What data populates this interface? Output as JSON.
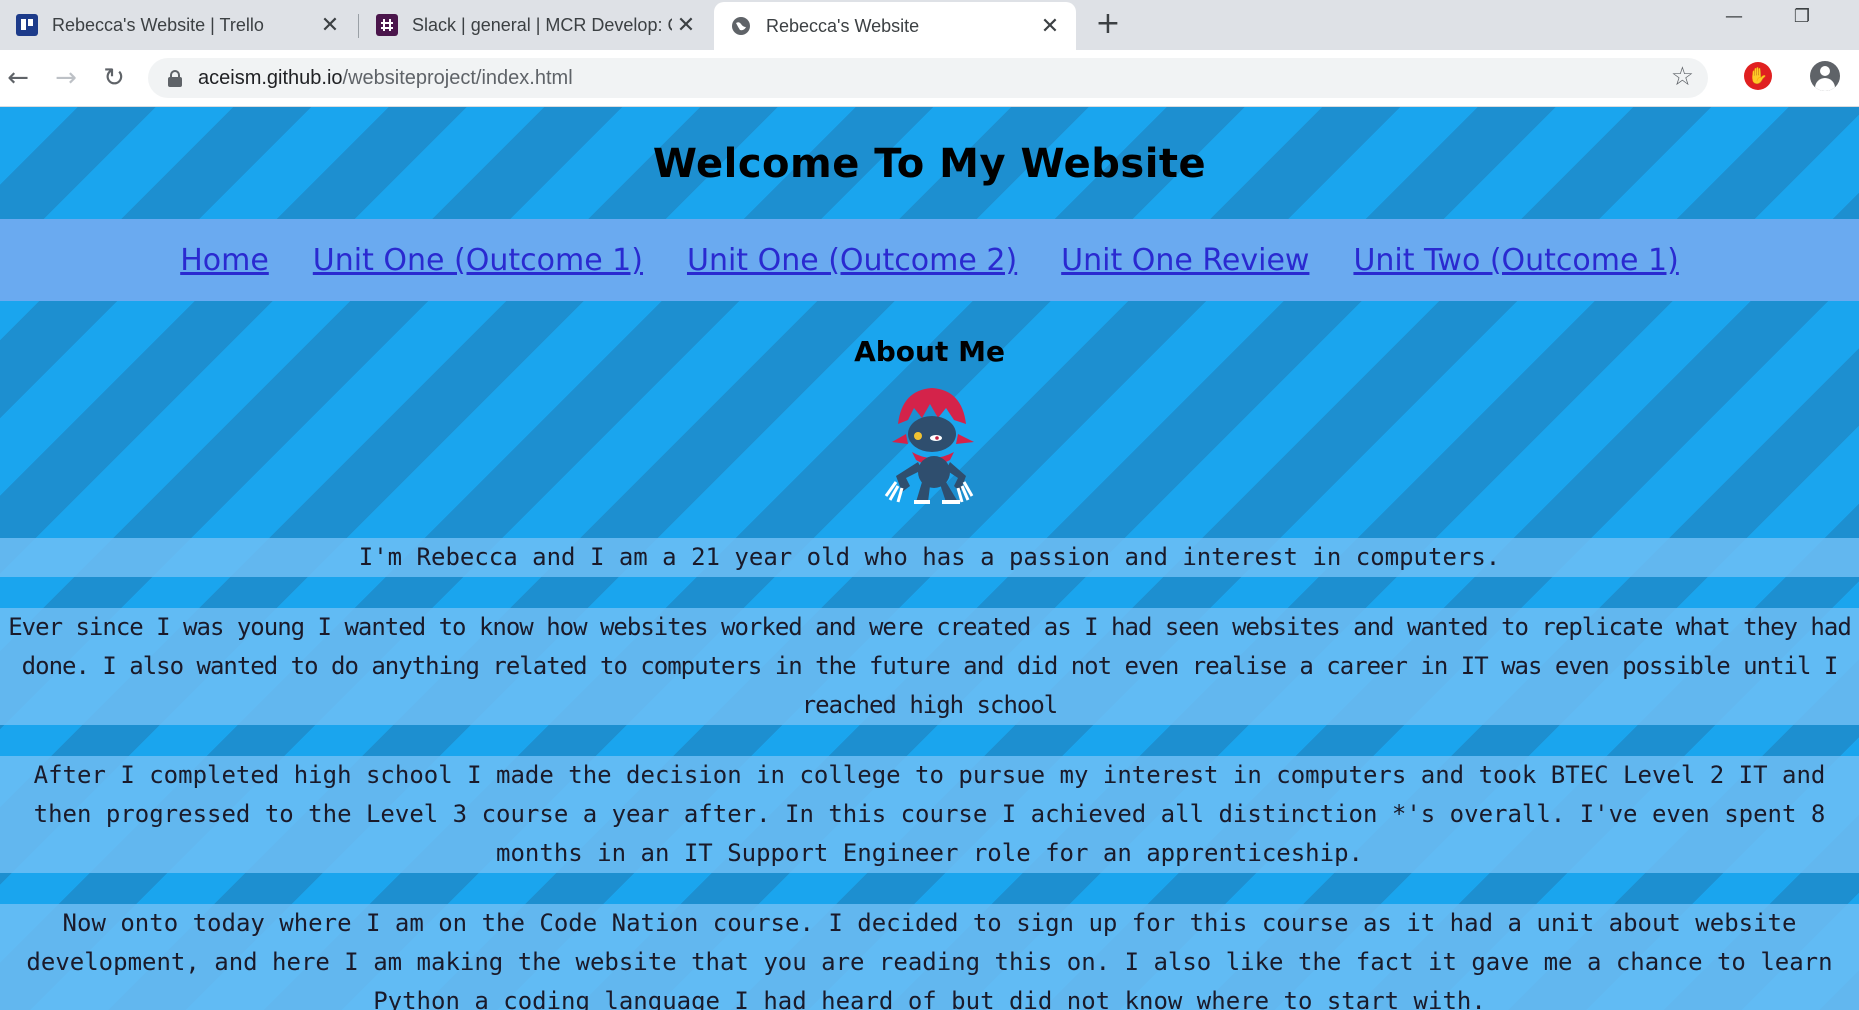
{
  "browser": {
    "tabs": [
      {
        "title": "Rebecca's Website | Trello",
        "icon": "trello-icon",
        "active": false
      },
      {
        "title": "Slack | general | MCR Develop: Co",
        "icon": "slack-icon",
        "active": false
      },
      {
        "title": "Rebecca's Website",
        "icon": "globe-icon",
        "active": true
      }
    ],
    "new_tab_label": "+",
    "window_controls": {
      "minimize": "—",
      "restore": "❐"
    },
    "address": {
      "host": "aceism.github.io",
      "path": "/websiteproject/index.html"
    },
    "extension_badge": "⬤"
  },
  "page": {
    "title": "Welcome To My Website",
    "nav": [
      {
        "label": "Home"
      },
      {
        "label": "Unit One (Outcome 1)"
      },
      {
        "label": "Unit One (Outcome 2)"
      },
      {
        "label": "Unit One Review"
      },
      {
        "label": "Unit Two (Outcome 1)"
      }
    ],
    "about_heading": "About Me",
    "image_name": "weavile-sprite",
    "paragraphs": [
      "I'm Rebecca and I am a 21 year old who has a passion and interest in computers.",
      "Ever since I was young I wanted to know how websites worked and were created as I had seen websites and wanted to replicate what they had done. I also wanted to do anything related to computers in the future and did not even realise a career in IT was even possible until I reached high school",
      "After I completed high school I made the decision in college to pursue my interest in computers and took BTEC Level 2 IT and then progressed to the Level 3 course a year after. In this course I achieved all distinction *'s overall. I've even spent 8 months in an IT Support Engineer role for an apprenticeship.",
      "Now onto today where I am on the Code Nation course. I decided to sign up for this course as it had a unit about website development, and here I am making the website that you are reading this on. I also like the fact it gave me a chance to learn Python a coding language I had heard of but did not know where to start with."
    ]
  },
  "colors": {
    "stripe_light": "#1aa5ee",
    "stripe_dark": "#1d8fd0",
    "nav_bg": "#6aaaf0",
    "link": "#2a2ad0",
    "paragraph_bg": "#6ebef5"
  }
}
